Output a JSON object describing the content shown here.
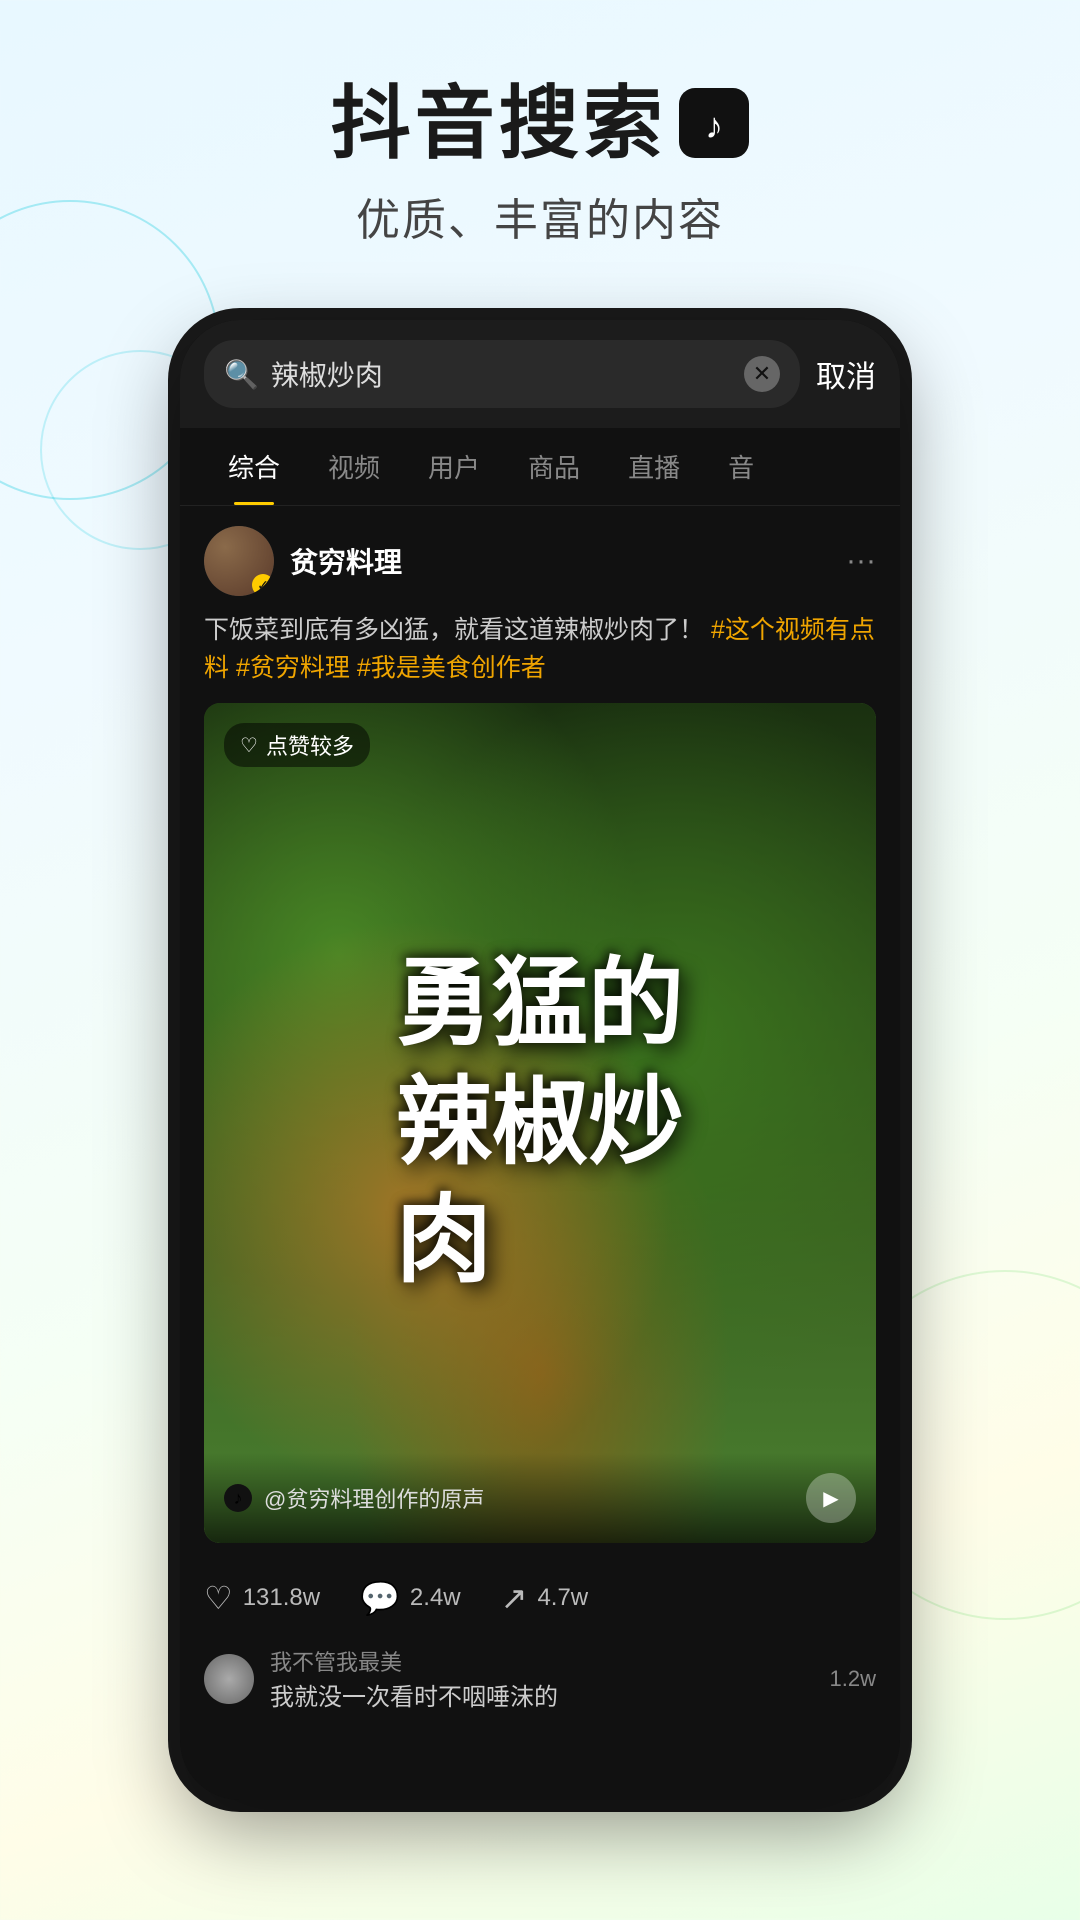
{
  "header": {
    "title": "抖音搜索",
    "subtitle": "优质、丰富的内容",
    "tiktok_icon": "♪"
  },
  "phone": {
    "search_bar": {
      "placeholder": "辣椒炒肉",
      "cancel_label": "取消",
      "search_icon": "🔍"
    },
    "tabs": [
      {
        "label": "综合",
        "active": true
      },
      {
        "label": "视频",
        "active": false
      },
      {
        "label": "用户",
        "active": false
      },
      {
        "label": "商品",
        "active": false
      },
      {
        "label": "直播",
        "active": false
      },
      {
        "label": "音",
        "active": false
      }
    ],
    "post": {
      "username": "贫穷料理",
      "verified": true,
      "description": "下饭菜到底有多凶猛，就看这道辣椒炒肉了！",
      "hashtags": [
        "#这个视频有点料",
        "#贫穷料理",
        "#我是美食创作者"
      ],
      "video": {
        "label_heart": "♡",
        "label_text": "点赞较多",
        "overlay_text": "勇猛的辣椒炒肉",
        "sound_text": "@贫穷料理创作的原声",
        "tiktok_symbol": "♪"
      },
      "interactions": {
        "likes": "131.8w",
        "comments": "2.4w",
        "shares": "4.7w"
      },
      "comment_preview": {
        "username": "我不管我最美",
        "text": "我就没一次看时不咽唾沫的",
        "count": "1.2w"
      }
    }
  }
}
